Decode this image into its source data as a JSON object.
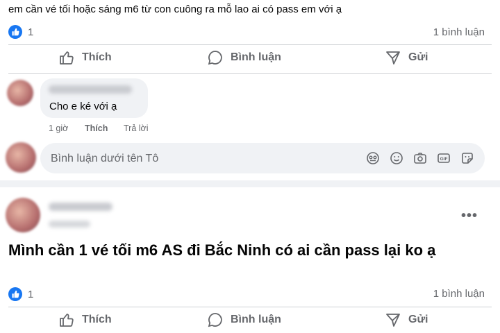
{
  "post1": {
    "text": "em cần vé tối hoặc sáng m6 từ con cuông ra mỗ lao ai có pass em với ạ",
    "reaction_count": "1",
    "comment_count": "1 bình luận",
    "actions": {
      "like": "Thích",
      "comment": "Bình luận",
      "share": "Gửi"
    },
    "comment": {
      "text": "Cho e ké với ạ",
      "time": "1 giờ",
      "like": "Thích",
      "reply": "Trả lời"
    },
    "comment_input": {
      "placeholder": "Bình luận dưới tên Tô"
    }
  },
  "post2": {
    "text": "Mình cần 1 vé tối m6 AS đi Bắc Ninh có ai cần pass lại ko ạ",
    "more": "•••",
    "reaction_count": "1",
    "comment_count": "1 bình luận",
    "actions": {
      "like": "Thích",
      "comment": "Bình luận",
      "share": "Gửi"
    }
  },
  "colors": {
    "accent": "#1877f2",
    "muted": "#65676b",
    "background": "#f0f2f5"
  }
}
